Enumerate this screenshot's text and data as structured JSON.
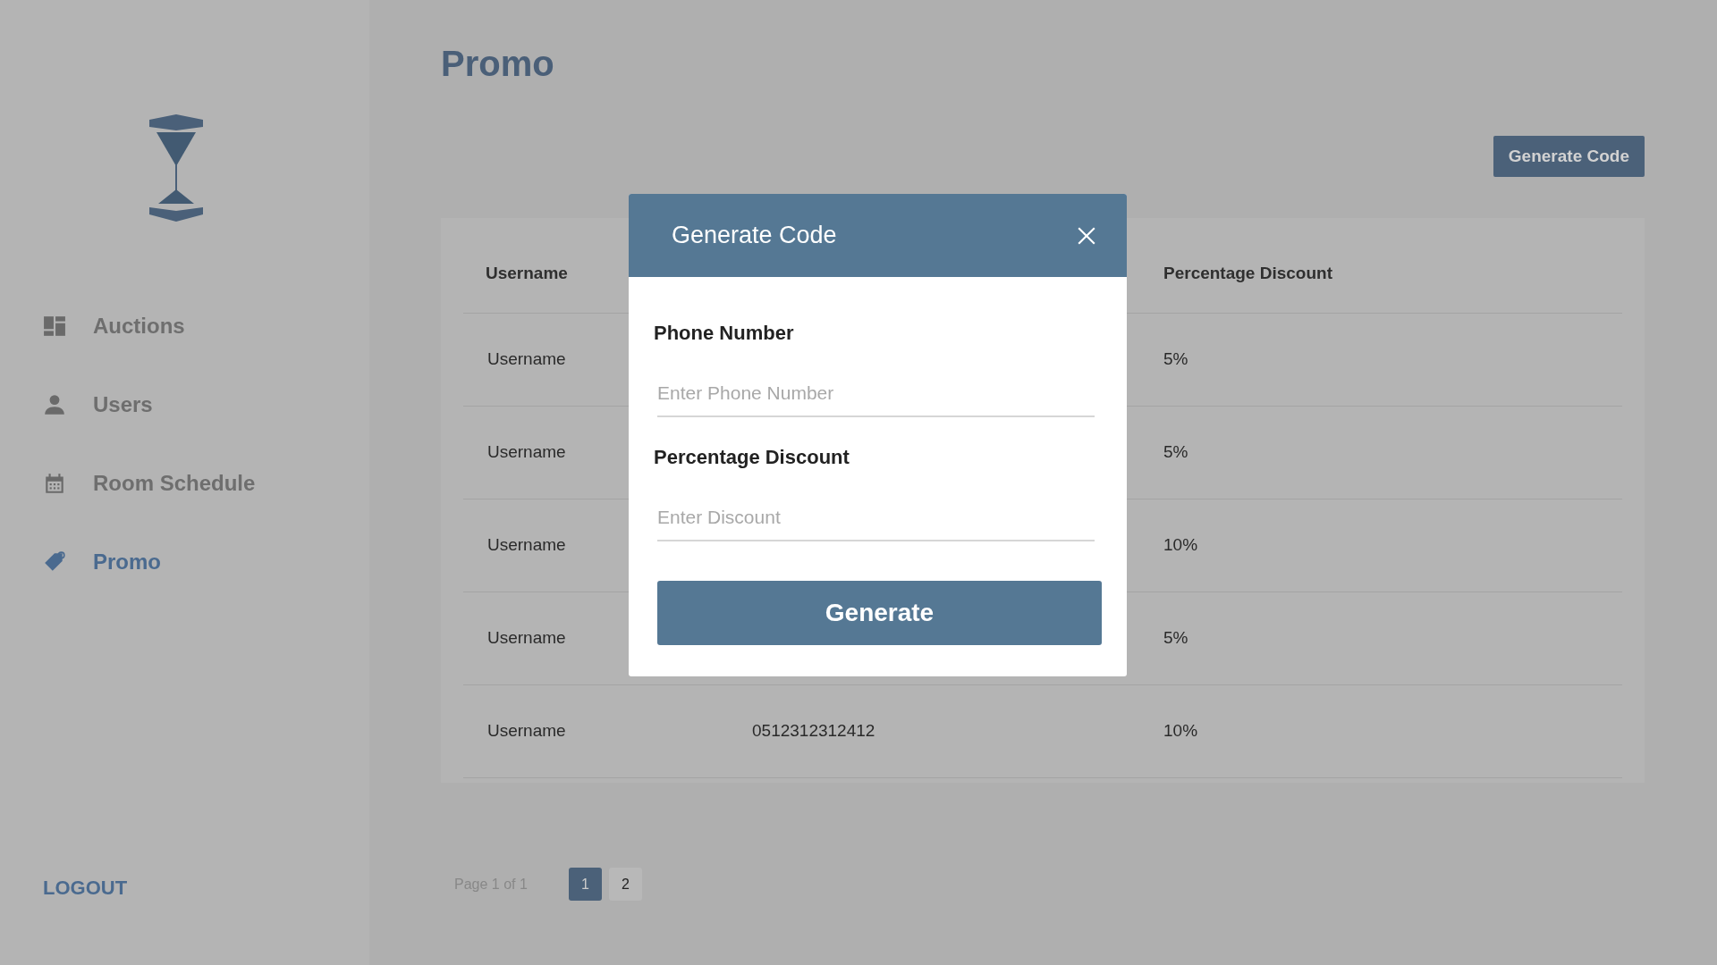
{
  "sidebar": {
    "items": [
      {
        "label": "Auctions",
        "selected": false
      },
      {
        "label": "Users",
        "selected": false
      },
      {
        "label": "Room Schedule",
        "selected": false
      },
      {
        "label": "Promo",
        "selected": true
      }
    ],
    "logout": "LOGOUT"
  },
  "page": {
    "title": "Promo",
    "action": "Generate Code"
  },
  "table": {
    "columns": [
      "Username",
      null,
      "Percentage Discount"
    ],
    "rows": [
      [
        "Username",
        null,
        "5%"
      ],
      [
        "Username",
        null,
        "5%"
      ],
      [
        "Username",
        null,
        "10%"
      ],
      [
        "Username",
        null,
        "5%"
      ],
      [
        "Username",
        "0512312312412",
        "10%"
      ]
    ]
  },
  "pagination": {
    "summary": "Page 1 of 1",
    "pages": [
      {
        "label": "1",
        "selected": true
      },
      {
        "label": "2",
        "selected": false
      }
    ]
  },
  "modal": {
    "title": "Generate Code",
    "fields": [
      {
        "label": "Phone Number",
        "placeholder": "Enter Phone Number"
      },
      {
        "label": "Percentage Discount",
        "placeholder": "Enter Discount"
      }
    ],
    "button": "Generate"
  }
}
